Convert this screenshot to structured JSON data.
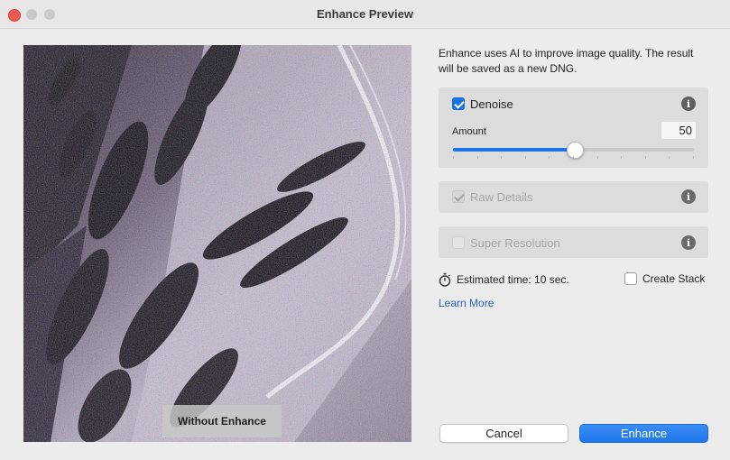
{
  "window": {
    "title": "Enhance Preview"
  },
  "preview": {
    "overlay_label": "Without Enhance"
  },
  "description": "Enhance uses AI to improve image quality. The result will be saved as a new DNG.",
  "options": {
    "denoise": {
      "label": "Denoise",
      "checked": true,
      "amount_label": "Amount",
      "amount_value": "50",
      "amount_fraction": 0.5
    },
    "raw_details": {
      "label": "Raw Details",
      "checked": true,
      "enabled": false
    },
    "super_resolution": {
      "label": "Super Resolution",
      "checked": false,
      "enabled": false
    }
  },
  "estimated_time": "Estimated time: 10 sec.",
  "create_stack": {
    "label": "Create Stack",
    "checked": false
  },
  "learn_more": "Learn More",
  "buttons": {
    "cancel": "Cancel",
    "enhance": "Enhance"
  },
  "icons": {
    "info": "i",
    "stopwatch": "stopwatch-icon"
  },
  "colors": {
    "accent": "#1a73e8",
    "link": "#2a62c9",
    "close_button": "#ee5a52"
  }
}
